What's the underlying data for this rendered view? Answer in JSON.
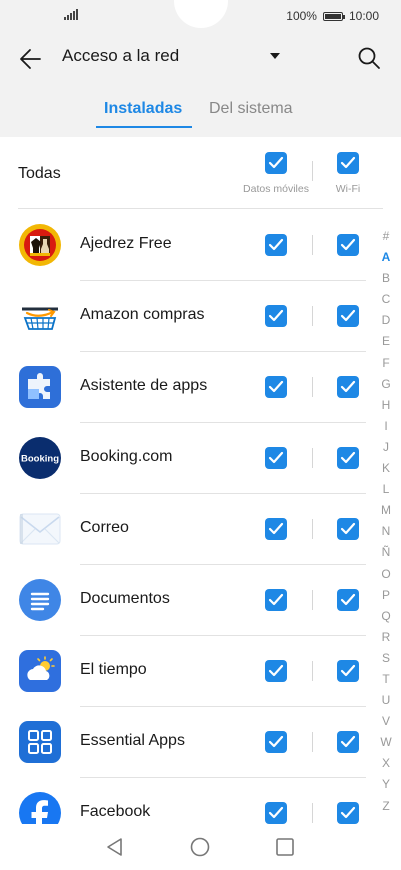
{
  "status_bar": {
    "battery_text": "100%",
    "battery_level": 1.0,
    "time": "10:00"
  },
  "header": {
    "title": "Acceso a la red",
    "back_icon": "arrow-left-icon",
    "search_icon": "search-icon",
    "dropdown_icon": "caret-down-icon"
  },
  "tabs": [
    {
      "label": "Instaladas",
      "active": true
    },
    {
      "label": "Del sistema",
      "active": false
    }
  ],
  "todas": {
    "label": "Todas",
    "mobile_label": "Datos móviles",
    "wifi_label": "Wi-Fi",
    "mobile_checked": true,
    "wifi_checked": true
  },
  "apps": [
    {
      "name": "Ajedrez Free",
      "icon": "chess-app-icon",
      "mobile": true,
      "wifi": true
    },
    {
      "name": "Amazon compras",
      "icon": "amazon-app-icon",
      "mobile": true,
      "wifi": true
    },
    {
      "name": "Asistente de apps",
      "icon": "puzzle-app-icon",
      "mobile": true,
      "wifi": true
    },
    {
      "name": "Booking.com",
      "icon": "booking-app-icon",
      "icon_text": "Booking",
      "mobile": true,
      "wifi": true
    },
    {
      "name": "Correo",
      "icon": "mail-app-icon",
      "mobile": true,
      "wifi": true
    },
    {
      "name": "Documentos",
      "icon": "documents-app-icon",
      "mobile": true,
      "wifi": true
    },
    {
      "name": "El tiempo",
      "icon": "weather-app-icon",
      "mobile": true,
      "wifi": true
    },
    {
      "name": "Essential Apps",
      "icon": "essential-apps-icon",
      "mobile": true,
      "wifi": true
    },
    {
      "name": "Facebook",
      "icon": "facebook-app-icon",
      "mobile": true,
      "wifi": true
    }
  ],
  "alphabet": [
    "#",
    "A",
    "B",
    "C",
    "D",
    "E",
    "F",
    "G",
    "H",
    "I",
    "J",
    "K",
    "L",
    "M",
    "N",
    "Ñ",
    "O",
    "P",
    "Q",
    "R",
    "S",
    "T",
    "U",
    "V",
    "W",
    "X",
    "Y",
    "Z"
  ],
  "alphabet_active": "A",
  "brand_colors": {
    "accent": "#1e88e5",
    "header_bg": "#f2f2f2"
  }
}
